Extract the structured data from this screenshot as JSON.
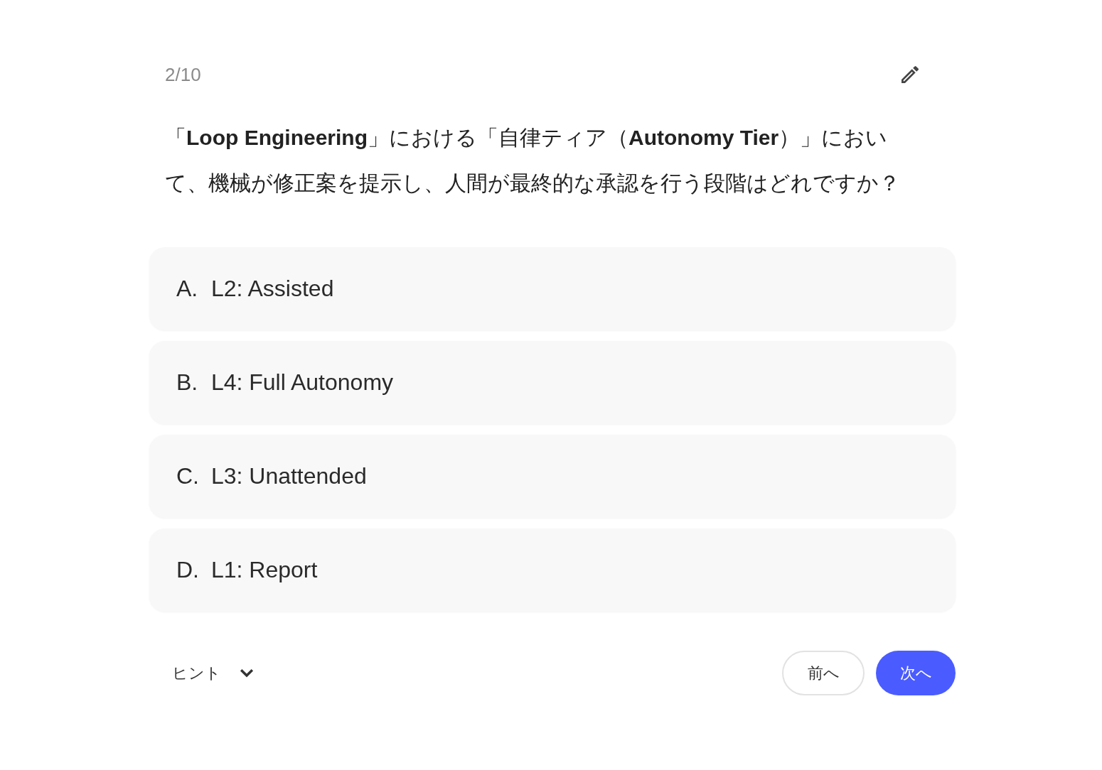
{
  "quiz": {
    "progress": "2/10",
    "question": "「**Loop Engineering**」における「自律ティア（**Autonomy Tier**）」において、機械が修正案を提示し、人間が最終的な承認を行う段階はどれですか？",
    "options": [
      {
        "letter": "A.",
        "text": "L2: Assisted",
        "selected": false
      },
      {
        "letter": "B.",
        "text": "L4: Full Autonomy",
        "selected": false
      },
      {
        "letter": "C.",
        "text": "L3: Unattended",
        "selected": false
      },
      {
        "letter": "D.",
        "text": "L1: Report",
        "selected": false
      }
    ],
    "hint": {
      "label": "ヒント",
      "expanded": false
    },
    "buttons": [
      {
        "label": "前へ",
        "kind": "secondary"
      },
      {
        "label": "次へ",
        "kind": "primary"
      }
    ]
  }
}
